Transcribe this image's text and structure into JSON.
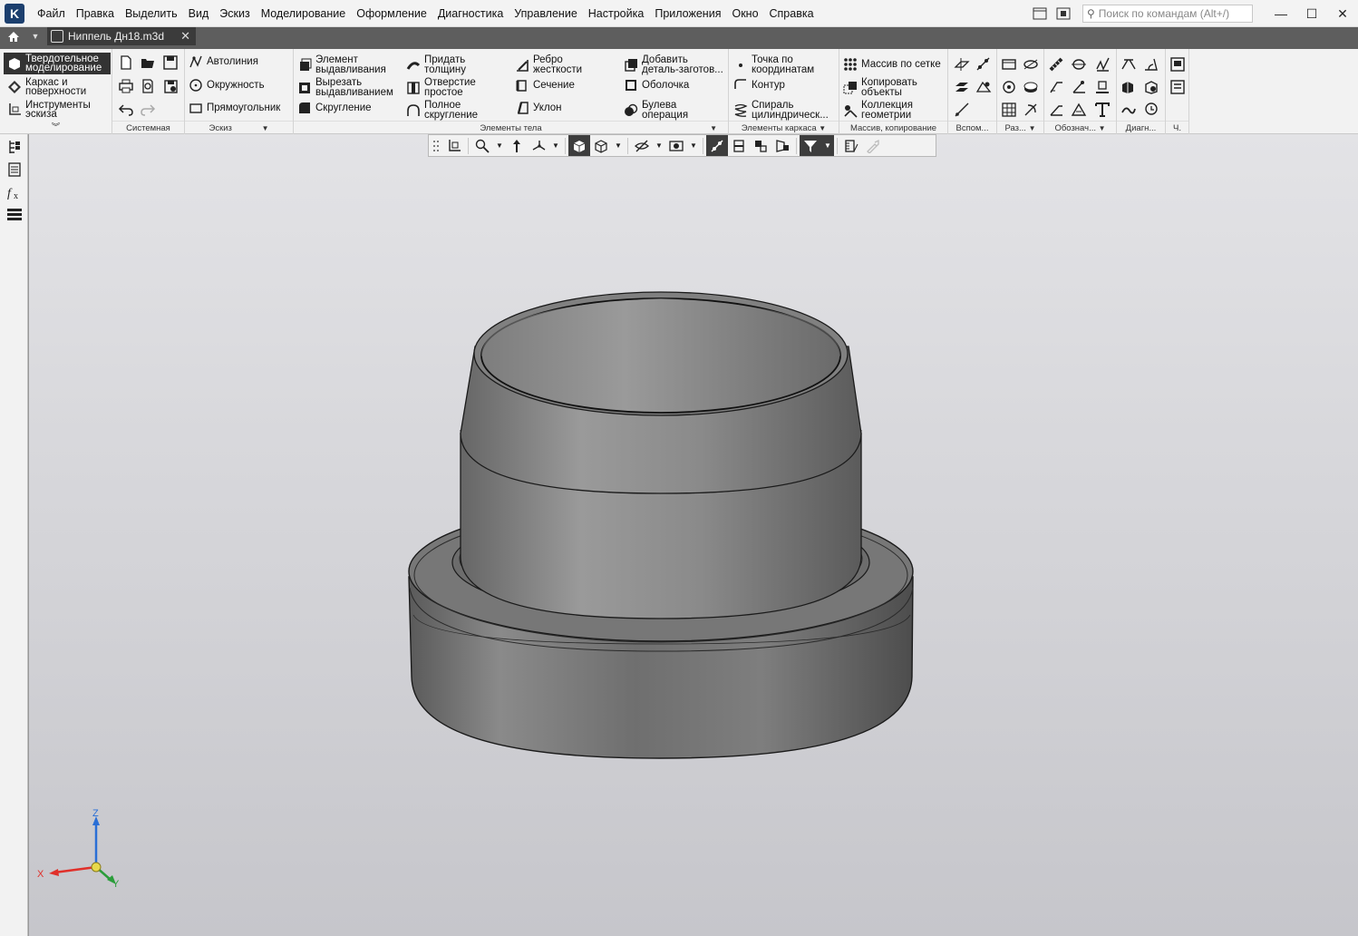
{
  "menu": {
    "items": [
      "Файл",
      "Правка",
      "Выделить",
      "Вид",
      "Эскиз",
      "Моделирование",
      "Оформление",
      "Диагностика",
      "Управление",
      "Настройка",
      "Приложения",
      "Окно",
      "Справка"
    ],
    "search_placeholder": "Поиск по командам (Alt+/)"
  },
  "tabs": {
    "document_title": "Ниппель Дн18.m3d"
  },
  "ribbon": {
    "modes": [
      {
        "label1": "Твердотельное",
        "label2": "моделирование"
      },
      {
        "label1": "Каркас и",
        "label2": "поверхности"
      },
      {
        "label1": "Инструменты",
        "label2": "эскиза"
      }
    ],
    "groups": {
      "system": "Системная",
      "sketch": "Эскиз",
      "body": "Элементы тела",
      "frame": "Элементы каркаса",
      "array": "Массив, копирование",
      "aux": "Вспом...",
      "dims": "Раз...",
      "designations": "Обознач...",
      "diagnostics": "Диагн...",
      "ch": "Ч."
    },
    "sketch_buttons": [
      "Автолиния",
      "Окружность",
      "Прямоугольник"
    ],
    "body_buttons": [
      {
        "l1": "Элемент",
        "l2": "выдавливания"
      },
      {
        "l1": "Вырезать",
        "l2": "выдавливанием"
      },
      {
        "l1": "Скругление",
        "l2": ""
      },
      {
        "l1": "Придать",
        "l2": "толщину"
      },
      {
        "l1": "Отверстие",
        "l2": "простое"
      },
      {
        "l1": "Полное",
        "l2": "скругление"
      },
      {
        "l1": "Ребро",
        "l2": "жесткости"
      },
      {
        "l1": "Сечение",
        "l2": ""
      },
      {
        "l1": "Уклон",
        "l2": ""
      },
      {
        "l1": "Добавить",
        "l2": "деталь-заготов..."
      },
      {
        "l1": "Оболочка",
        "l2": ""
      },
      {
        "l1": "Булева",
        "l2": "операция"
      }
    ],
    "frame_buttons": [
      {
        "l1": "Точка по",
        "l2": "координатам"
      },
      {
        "l1": "Контур",
        "l2": ""
      },
      {
        "l1": "Спираль",
        "l2": "цилиндрическ..."
      }
    ],
    "array_buttons": [
      {
        "l1": "Массив по сетке",
        "l2": ""
      },
      {
        "l1": "Копировать",
        "l2": "объекты"
      },
      {
        "l1": "Коллекция",
        "l2": "геометрии"
      }
    ]
  },
  "viewport": {
    "axes": {
      "x": "X",
      "y": "Y",
      "z": "Z"
    }
  },
  "colors": {
    "accent": "#1c3f6e",
    "model_body": "#8a8a8a",
    "axis_x": "#e0302a",
    "axis_y": "#2a9d3a",
    "axis_z": "#2a6fd6"
  }
}
